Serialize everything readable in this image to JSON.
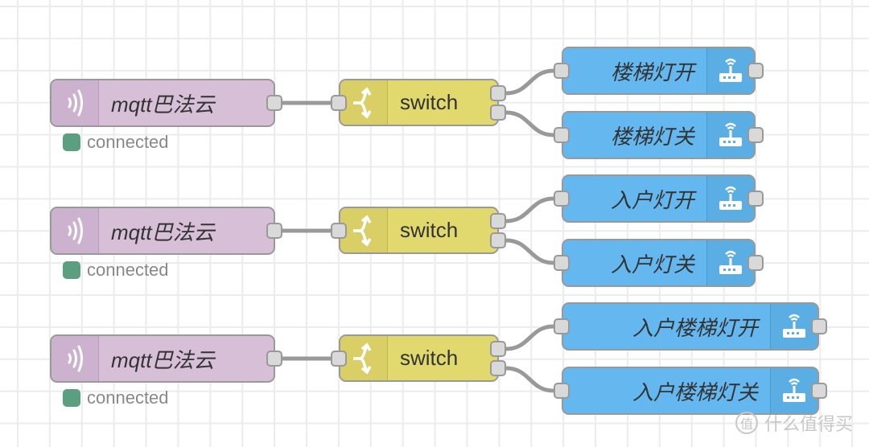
{
  "flows": [
    {
      "input": {
        "type": "mqtt in",
        "label": "mqtt巴法云",
        "icon": "bridge-icon",
        "status_text": "connected",
        "status_color": "#5c9e80"
      },
      "switch": {
        "label": "switch",
        "icon": "switch-icon"
      },
      "outputs": [
        {
          "label": "楼梯灯开",
          "icon": "router-icon"
        },
        {
          "label": "楼梯灯关",
          "icon": "router-icon"
        }
      ]
    },
    {
      "input": {
        "type": "mqtt in",
        "label": "mqtt巴法云",
        "icon": "bridge-icon",
        "status_text": "connected",
        "status_color": "#5c9e80"
      },
      "switch": {
        "label": "switch",
        "icon": "switch-icon"
      },
      "outputs": [
        {
          "label": "入户灯开",
          "icon": "router-icon"
        },
        {
          "label": "入户灯关",
          "icon": "router-icon"
        }
      ]
    },
    {
      "input": {
        "type": "mqtt in",
        "label": "mqtt巴法云",
        "icon": "bridge-icon",
        "status_text": "connected",
        "status_color": "#5c9e80"
      },
      "switch": {
        "label": "switch",
        "icon": "switch-icon"
      },
      "outputs": [
        {
          "label": "入户楼梯灯开",
          "icon": "router-icon"
        },
        {
          "label": "入户楼梯灯关",
          "icon": "router-icon"
        }
      ]
    }
  ],
  "colors": {
    "mqtt_node": "#d7bfd8",
    "switch_node": "#e2d96e",
    "output_node": "#65b8ef",
    "link": "#999999"
  },
  "watermark": {
    "badge": "值",
    "text": "什么值得买"
  }
}
